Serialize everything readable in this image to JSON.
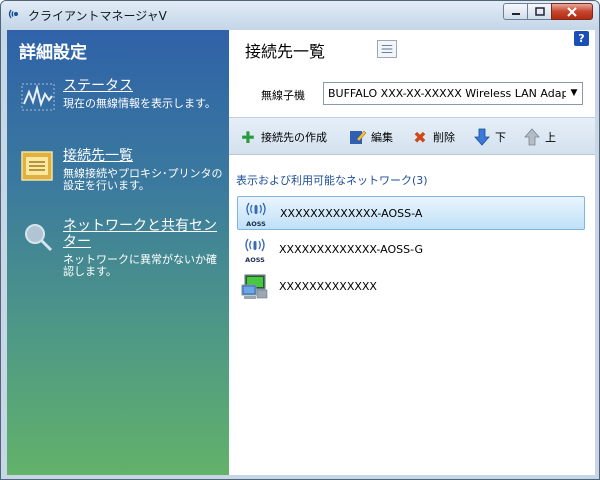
{
  "window": {
    "title": "クライアントマネージャV"
  },
  "left": {
    "title": "詳細設定",
    "items": [
      {
        "label": "ステータス",
        "desc": "現在の無線情報を表示します。"
      },
      {
        "label": "接続先一覧",
        "desc": "無線接続やプロキシ･プリンタの設定を行います。"
      },
      {
        "label": "ネットワークと共有センター",
        "desc": "ネットワークに異常がないか確認します。"
      }
    ]
  },
  "right": {
    "title": "接続先一覧",
    "help": "?",
    "adapter_label": "無線子機",
    "adapter_value": "BUFFALO XXX-XX-XXXXX Wireless LAN Adapter",
    "toolbar": {
      "create": "接続先の作成",
      "edit": "編集",
      "delete": "削除",
      "down": "下",
      "up": "上"
    },
    "section_title": "表示および利用可能なネットワーク(3)",
    "networks": [
      {
        "name": "XXXXXXXXXXXXX-AOSS-A",
        "badge": "AOSS"
      },
      {
        "name": "XXXXXXXXXXXXX-AOSS-G",
        "badge": "AOSS"
      },
      {
        "name": "XXXXXXXXXXXXX"
      }
    ]
  }
}
